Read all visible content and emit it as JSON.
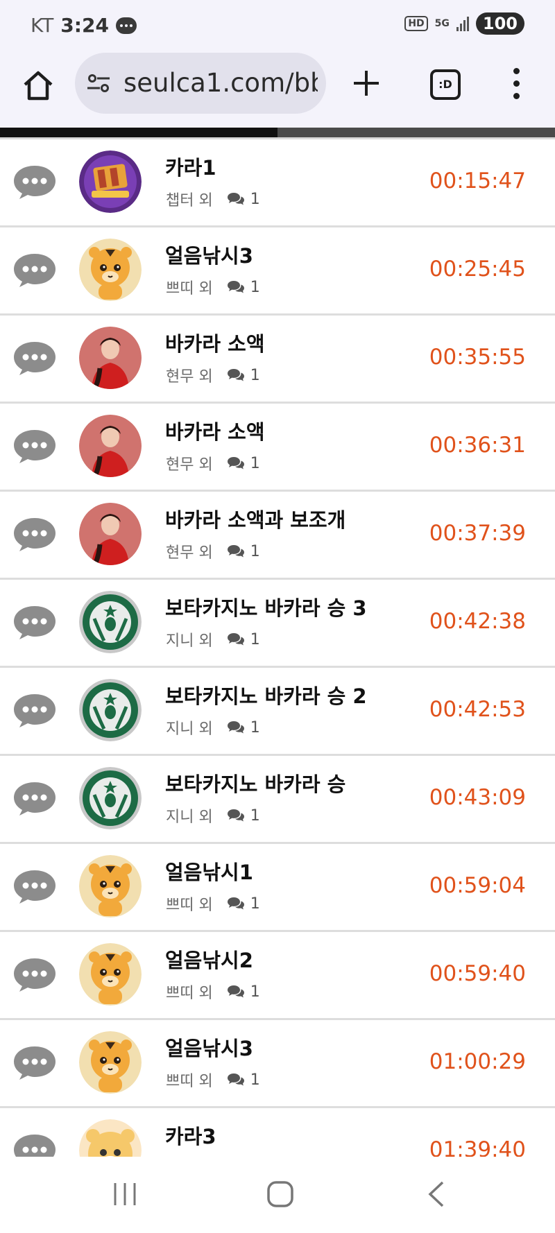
{
  "status_bar": {
    "carrier": "KT",
    "time": "3:24",
    "network": "5G",
    "battery": "100"
  },
  "browser": {
    "url": "seulca1.com/bb",
    "tabs_label": ":D",
    "load_progress": 0.5
  },
  "colors": {
    "time_accent": "#e0521b",
    "bars": "#f4f3fb"
  },
  "rows": [
    {
      "title": "카라1",
      "author": "챕터 외",
      "count": "1",
      "time": "00:15:47",
      "avatar": "merlin"
    },
    {
      "title": "얼음낚시3",
      "author": "쁘띠 외",
      "count": "1",
      "time": "00:25:45",
      "avatar": "tiger"
    },
    {
      "title": "바카라 소액",
      "author": "현무 외",
      "count": "1",
      "time": "00:35:55",
      "avatar": "woman-red"
    },
    {
      "title": "바카라 소액",
      "author": "현무 외",
      "count": "1",
      "time": "00:36:31",
      "avatar": "woman-red"
    },
    {
      "title": "바카라 소액과 보조개",
      "author": "현무 외",
      "count": "1",
      "time": "00:37:39",
      "avatar": "woman-red"
    },
    {
      "title": "보타카지노 바카라 승 3",
      "author": "지니 외",
      "count": "1",
      "time": "00:42:38",
      "avatar": "siren-logo"
    },
    {
      "title": "보타카지노 바카라 승 2",
      "author": "지니 외",
      "count": "1",
      "time": "00:42:53",
      "avatar": "siren-logo"
    },
    {
      "title": "보타카지노 바카라 승",
      "author": "지니 외",
      "count": "1",
      "time": "00:43:09",
      "avatar": "siren-logo"
    },
    {
      "title": "얼음낚시1",
      "author": "쁘띠 외",
      "count": "1",
      "time": "00:59:04",
      "avatar": "tiger"
    },
    {
      "title": "얼음낚시2",
      "author": "쁘띠 외",
      "count": "1",
      "time": "00:59:40",
      "avatar": "tiger"
    },
    {
      "title": "얼음낚시3",
      "author": "쁘띠 외",
      "count": "1",
      "time": "01:00:29",
      "avatar": "tiger"
    },
    {
      "title": "카라3",
      "author": "",
      "count": "",
      "time": "01:39:40",
      "avatar": "tiger-cute"
    }
  ]
}
